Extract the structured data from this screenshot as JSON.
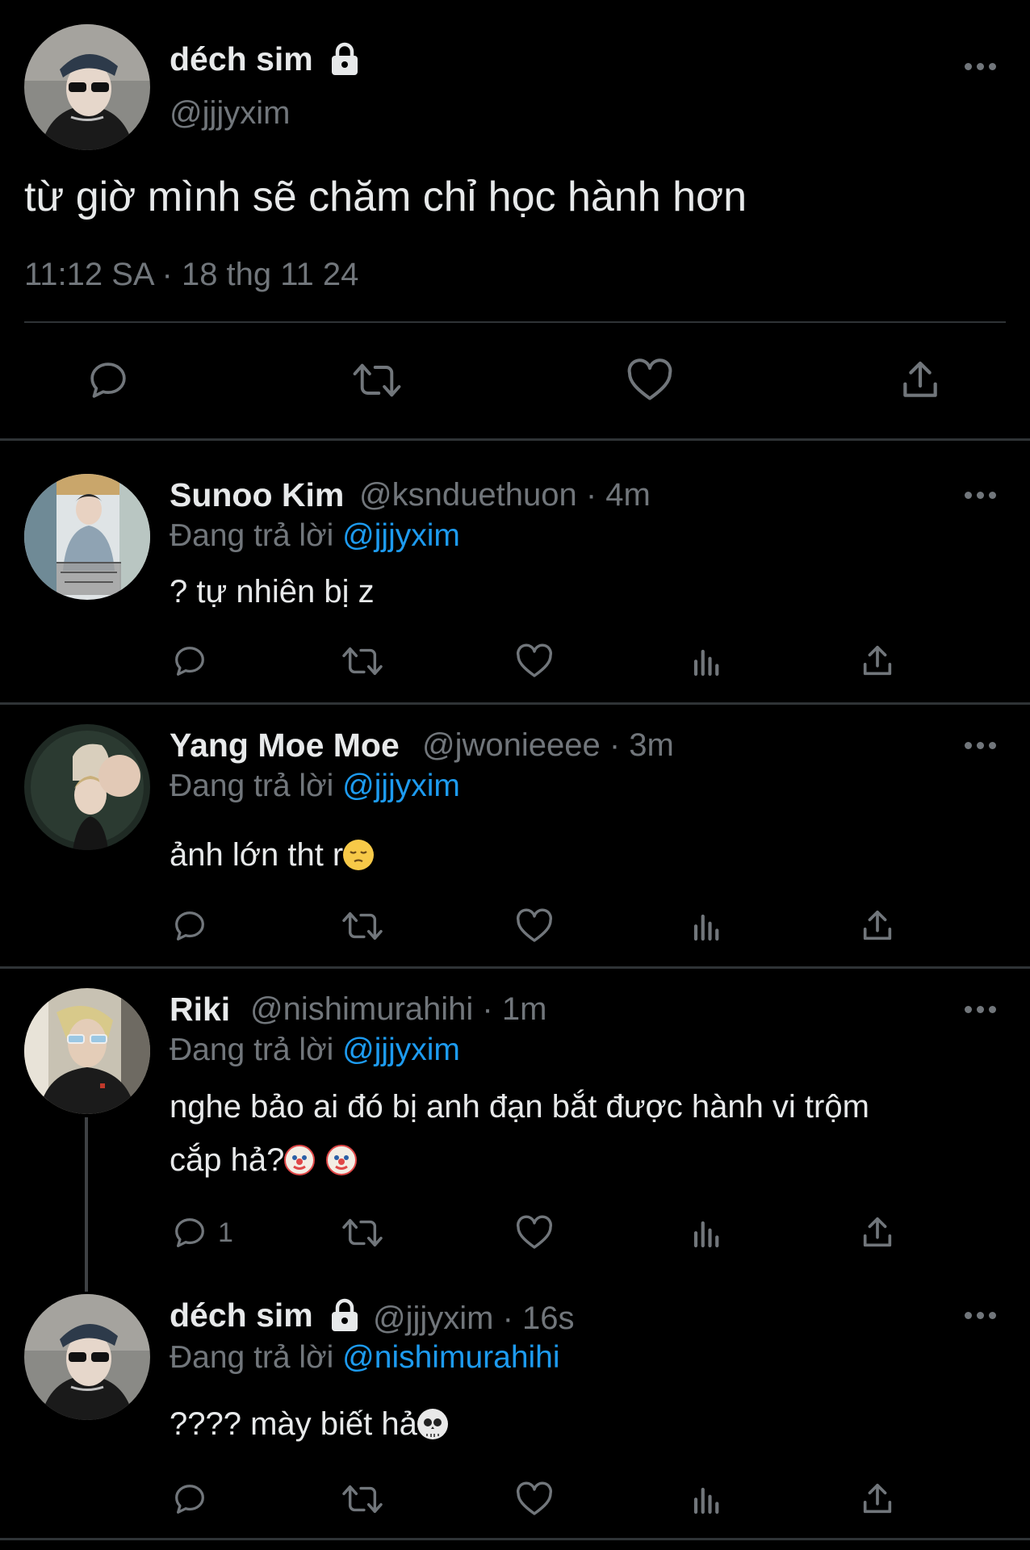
{
  "main_tweet": {
    "display_name": "déch sim",
    "handle": "@jjjyxim",
    "text": "từ giờ mình sẽ chăm chỉ học hành hơn",
    "timestamp": "11:12 SA · 18 thg 11 24",
    "lock_icon": "lock-icon",
    "actions": [
      "reply-icon",
      "retweet-icon",
      "like-icon",
      "share-icon"
    ]
  },
  "replies": [
    {
      "display_name": "Sunoo Kim",
      "handle": "@ksnduethuon",
      "time": "· 4m",
      "replying_prefix": "Đang trả lời",
      "replying_to": "@jjjyxim",
      "text": "? tự nhiên bị z",
      "reply_count": ""
    },
    {
      "display_name": "Yang Moe Moe",
      "handle": "@jwonieeee",
      "time": "· 3m",
      "replying_prefix": "Đang trả lời",
      "replying_to": "@jjjyxim",
      "text": "ảnh lớn tht r",
      "emoji": "pensive-face",
      "reply_count": ""
    },
    {
      "display_name": "Riki",
      "handle": "@nishimurahihi",
      "time": "· 1m",
      "replying_prefix": "Đang trả lời",
      "replying_to": "@jjjyxim",
      "text_line1": "nghe bảo ai đó bị anh đạn bắt được hành vi trộm",
      "text_line2": "cắp hả?",
      "emoji": "clown-face",
      "reply_count": "1"
    },
    {
      "display_name": "déch sim",
      "handle": "@jjjyxim",
      "time": "· 16s",
      "replying_prefix": "Đang trả lời",
      "replying_to": "@nishimurahihi",
      "text": "???? mày biết hả",
      "emoji": "skull",
      "reply_count": ""
    }
  ],
  "colors": {
    "background": "#000000",
    "text": "#e7e9ea",
    "secondary": "#71767b",
    "link": "#1d9bf0",
    "divider": "#2f3336"
  }
}
